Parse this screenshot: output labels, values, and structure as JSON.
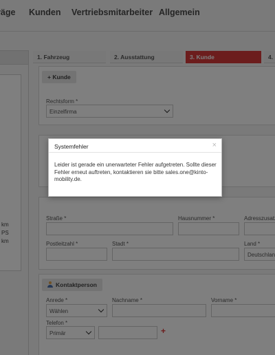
{
  "nav": {
    "items": [
      "räge",
      "Kunden",
      "Vertriebsmitarbeiter",
      "Allgemein"
    ]
  },
  "left_panel": {
    "specs": [
      "km",
      "PS",
      "km"
    ]
  },
  "stepper": {
    "steps": [
      "1. Fahrzeug",
      "2. Ausstattung",
      "3. Kunde",
      "4."
    ],
    "active_index": 2
  },
  "kunde": {
    "header": "+ Kunde",
    "rechtsform_label": "Rechtsform *",
    "rechtsform_value": "Einzelfirma"
  },
  "address": {
    "strasse_label": "Straße *",
    "hausnummer_label": "Hausnummer *",
    "adresszusatz_label": "Adresszusatz",
    "postleitzahl_label": "Postleitzahl *",
    "stadt_label": "Stadt *",
    "land_label": "Land *",
    "land_value": "Deutschland"
  },
  "kontakt": {
    "header": "Kontaktperson",
    "anrede_label": "Anrede *",
    "anrede_value": "Wählen",
    "nachname_label": "Nachname *",
    "vorname_label": "Vorname *",
    "telefon_label": "Telefon *",
    "telefon_type": "Primär",
    "add_symbol": "+"
  },
  "dialog": {
    "title": "Systemfehler",
    "close": "×",
    "message": "Leider ist gerade ein unerwarteter Fehler aufgetreten. Sollte dieser Fehler erneut auftreten, kontaktieren sie bitte sales.one@kinto-mobility.de."
  },
  "colors": {
    "accent": "#d83a3a",
    "overlay": "rgba(0,0,0,0.5)"
  }
}
